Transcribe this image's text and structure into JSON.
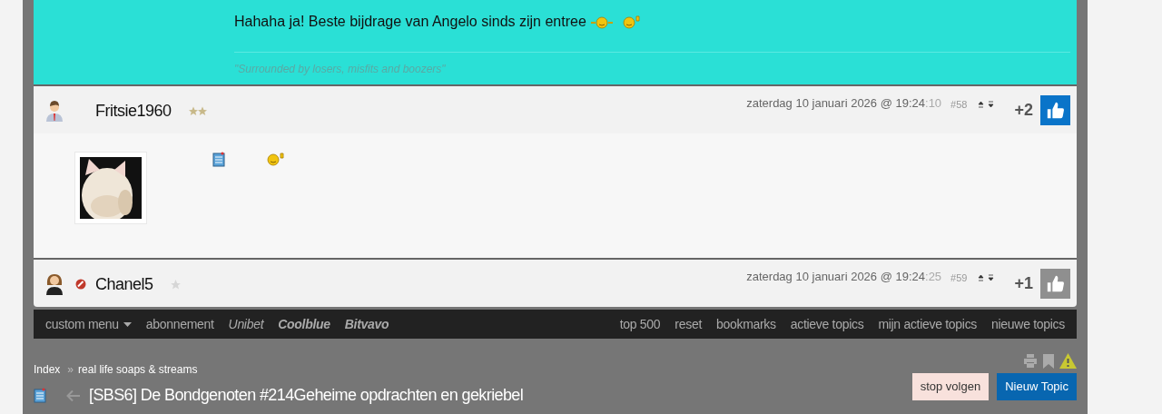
{
  "top_post": {
    "message": "Hahaha ja! Beste bijdrage van Angelo sinds zijn entree",
    "signature": "\"Surrounded by losers, misfits and boozers\""
  },
  "posts": [
    {
      "username": "Fritsie1960",
      "kind": "man",
      "ignored": false,
      "ranked": true,
      "date": "zaterdag 10 januari 2026 @ 19:24",
      "seconds": ":10",
      "number": "#58",
      "score": "+2",
      "liked": true
    },
    {
      "username": "Chanel5",
      "kind": "woman",
      "ignored": true,
      "ranked": false,
      "date": "zaterdag 10 januari 2026 @ 19:24",
      "seconds": ":25",
      "number": "#59",
      "score": "+1",
      "liked": false
    }
  ],
  "menu_left": [
    {
      "label": "custom menu",
      "kind": "dropdown"
    },
    {
      "label": "abonnement",
      "kind": "plain"
    },
    {
      "label": "Unibet",
      "kind": "italic"
    },
    {
      "label": "Coolblue",
      "kind": "bold_italic"
    },
    {
      "label": "Bitvavo",
      "kind": "bold_italic"
    }
  ],
  "menu_right": [
    "top 500",
    "reset",
    "bookmarks",
    "actieve topics",
    "mijn actieve topics",
    "nieuwe topics"
  ],
  "breadcrumbs": [
    "Index",
    "real life soaps & streams"
  ],
  "breadcrumb_separator": "»",
  "topic_title": "[SBS6] De Bondgenoten #214Geheime opdrachten en gekriebel",
  "buttons": [
    {
      "label": "stop volgen",
      "kind": "secondary"
    },
    {
      "label": "Nieuw Topic",
      "kind": "primary"
    }
  ]
}
